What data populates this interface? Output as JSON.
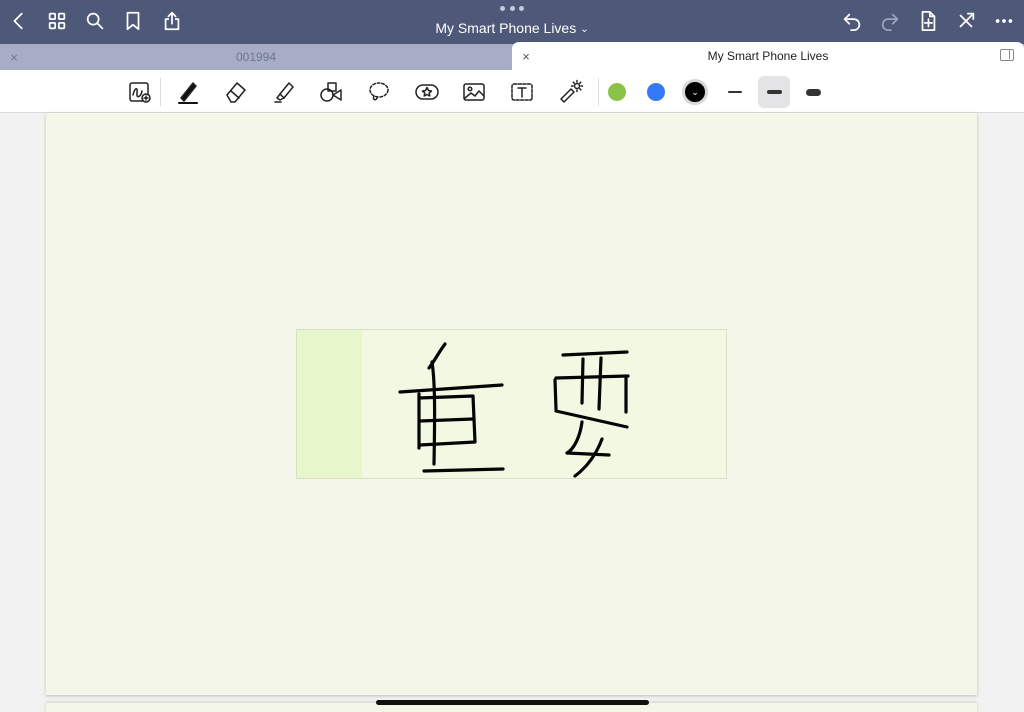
{
  "window": {
    "title": "My Smart Phone Lives",
    "title_chevron": "⌄"
  },
  "tabs": [
    {
      "label": "001994",
      "close": "×",
      "active": false
    },
    {
      "label": "My Smart Phone Lives",
      "close": "×",
      "active": true
    }
  ],
  "top_left_icons": [
    "back-chevron-icon",
    "thumbnails-grid-icon",
    "search-icon",
    "bookmark-icon",
    "share-icon"
  ],
  "top_right_icons": [
    "undo-icon",
    "redo-icon",
    "add-page-icon",
    "close-pen-icon",
    "more-icon"
  ],
  "toolbar": {
    "tools": [
      "zoom-window-icon",
      "pen-icon",
      "eraser-icon",
      "highlighter-icon",
      "shapes-icon",
      "lasso-icon",
      "elements-sticker-icon",
      "image-icon",
      "text-box-icon",
      "laser-pointer-icon"
    ],
    "active_tool": "pen-icon",
    "colors": [
      "#8bc34a",
      "#3478f6",
      "#000000"
    ],
    "selected_color": "#000000",
    "selected_color_indicator": "⌄",
    "stroke_widths": [
      "thin",
      "medium",
      "thick"
    ],
    "selected_stroke": "medium"
  },
  "canvas": {
    "page_color": "#f5f6ea",
    "sticky_note_color": "#f2f8e2",
    "sticky_note_tab_color": "#e7f7cb",
    "handwriting": "重要"
  }
}
